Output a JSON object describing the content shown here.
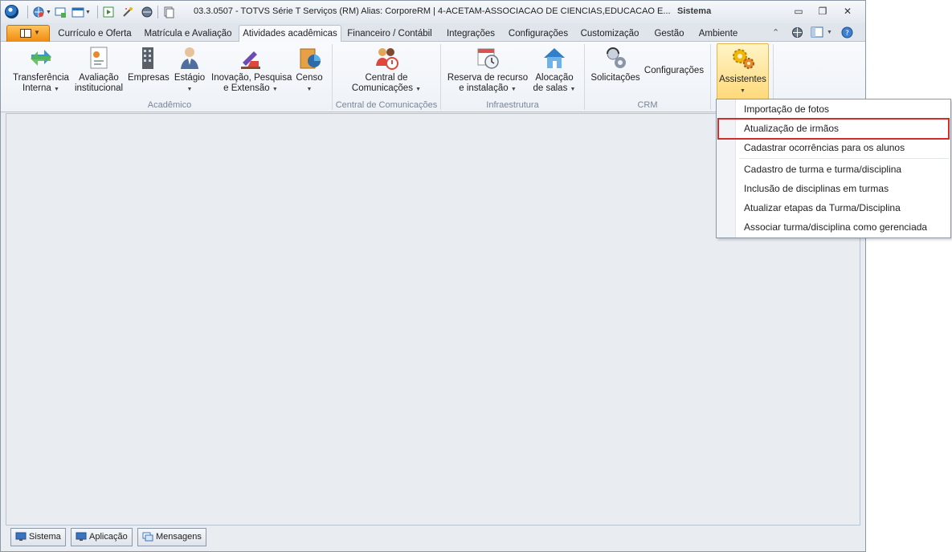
{
  "titlebar": {
    "title": "03.3.0507 - TOTVS Série T Serviços (RM) Alias: CorporeRM | 4-ACETAM-ASSOCIACAO DE CIENCIAS,EDUCACAO E...",
    "section": "Sistema",
    "minimize": "▭",
    "restore": "❐",
    "close": "✕"
  },
  "tabs": [
    {
      "label": "Currículo e Oferta"
    },
    {
      "label": "Matrícula e Avaliação"
    },
    {
      "label": "Atividades acadêmicas"
    },
    {
      "label": "Financeiro / Contábil"
    },
    {
      "label": "Integrações"
    },
    {
      "label": "Configurações"
    },
    {
      "label": "Customização"
    },
    {
      "label": "Gestão"
    },
    {
      "label": "Ambiente"
    }
  ],
  "active_tab": "Atividades acadêmicas",
  "ribbon": {
    "groups": [
      {
        "label": "Acadêmico",
        "buttons": [
          {
            "line1": "Transferência",
            "line2": "Interna",
            "icon": "transfer-arrows-icon"
          },
          {
            "line1": "Avaliação",
            "line2": "institucional",
            "icon": "evaluation-document-icon"
          },
          {
            "line1": "Empresas",
            "line2": "",
            "icon": "building-icon"
          },
          {
            "line1": "Estágio",
            "line2": "",
            "icon": "person-icon"
          },
          {
            "line1": "Inovação, Pesquisa",
            "line2": "e Extensão",
            "icon": "microscope-icon"
          },
          {
            "line1": "Censo",
            "line2": "",
            "icon": "pie-chart-icon"
          }
        ]
      },
      {
        "label": "Central de Comunicações",
        "buttons": [
          {
            "line1": "Central de",
            "line2": "Comunicações",
            "icon": "people-alert-icon"
          }
        ]
      },
      {
        "label": "Infraestrutura",
        "buttons": [
          {
            "line1": "Reserva de recurso",
            "line2": "e instalação",
            "icon": "calendar-clock-icon"
          },
          {
            "line1": "Alocação",
            "line2": "de salas",
            "icon": "house-icon"
          }
        ]
      },
      {
        "label": "CRM",
        "buttons": [
          {
            "line1": "Solicitações",
            "line2": "",
            "icon": "headset-icon"
          },
          {
            "line1": "Configurações",
            "line2": "",
            "icon": ""
          }
        ]
      },
      {
        "label": "",
        "buttons": [
          {
            "line1": "Assistentes",
            "line2": "",
            "icon": "gears-icon"
          }
        ]
      }
    ]
  },
  "assistentes_menu": {
    "items": [
      {
        "label": "Importação de fotos"
      },
      {
        "label": "Atualização de irmãos"
      },
      {
        "label": "Cadastrar ocorrências para os alunos"
      },
      {
        "label": "Cadastro de turma e turma/disciplina"
      },
      {
        "label": "Inclusão de disciplinas em turmas"
      },
      {
        "label": "Atualizar etapas da Turma/Disciplina"
      },
      {
        "label": "Associar turma/disciplina como gerenciada"
      }
    ],
    "highlighted": "Atualização de irmãos",
    "highlight_color": "#d62b2b"
  },
  "bottom_tabs": [
    {
      "label": "Sistema"
    },
    {
      "label": "Aplicação"
    },
    {
      "label": "Mensagens"
    }
  ],
  "colors": {
    "file_tab": "#f08a0e",
    "ribbon_bg": "#eef2f7",
    "workspace_bg": "#e9ecf1",
    "selected_button": "#ffd97a"
  }
}
